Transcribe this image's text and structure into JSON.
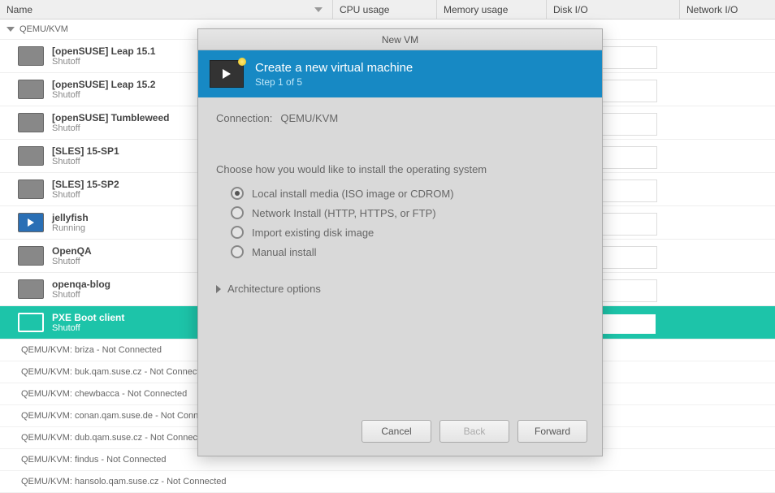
{
  "columns": {
    "name": "Name",
    "cpu": "CPU usage",
    "mem": "Memory usage",
    "disk": "Disk I/O",
    "net": "Network I/O"
  },
  "group": {
    "label": "QEMU/KVM"
  },
  "vms": [
    {
      "name": "[openSUSE] Leap 15.1",
      "status": "Shutoff",
      "running": false,
      "selected": false
    },
    {
      "name": "[openSUSE] Leap 15.2",
      "status": "Shutoff",
      "running": false,
      "selected": false
    },
    {
      "name": "[openSUSE] Tumbleweed",
      "status": "Shutoff",
      "running": false,
      "selected": false
    },
    {
      "name": "[SLES] 15-SP1",
      "status": "Shutoff",
      "running": false,
      "selected": false
    },
    {
      "name": "[SLES] 15-SP2",
      "status": "Shutoff",
      "running": false,
      "selected": false
    },
    {
      "name": "jellyfish",
      "status": "Running",
      "running": true,
      "selected": false
    },
    {
      "name": "OpenQA",
      "status": "Shutoff",
      "running": false,
      "selected": false
    },
    {
      "name": "openqa-blog",
      "status": "Shutoff",
      "running": false,
      "selected": false
    },
    {
      "name": "PXE Boot client",
      "status": "Shutoff",
      "running": false,
      "selected": true
    }
  ],
  "connections": [
    "QEMU/KVM: briza - Not Connected",
    "QEMU/KVM: buk.qam.suse.cz - Not Connected",
    "QEMU/KVM: chewbacca - Not Connected",
    "QEMU/KVM: conan.qam.suse.de - Not Connec",
    "QEMU/KVM: dub.qam.suse.cz - Not Connected",
    "QEMU/KVM: findus - Not Connected",
    "QEMU/KVM: hansolo.qam.suse.cz - Not Connected"
  ],
  "dialog": {
    "window_title": "New VM",
    "title": "Create a new virtual machine",
    "step": "Step 1 of 5",
    "connection_label": "Connection:",
    "connection_value": "QEMU/KVM",
    "instruction": "Choose how you would like to install the operating system",
    "options": [
      {
        "label": "Local install media (ISO image or CDROM)",
        "checked": true
      },
      {
        "label": "Network Install (HTTP, HTTPS, or FTP)",
        "checked": false
      },
      {
        "label": "Import existing disk image",
        "checked": false
      },
      {
        "label": "Manual install",
        "checked": false
      }
    ],
    "arch": "Architecture options",
    "buttons": {
      "cancel": "Cancel",
      "back": "Back",
      "forward": "Forward"
    }
  }
}
